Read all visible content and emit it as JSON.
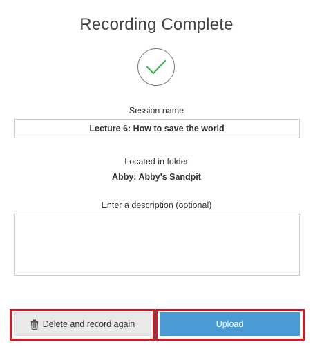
{
  "dialog": {
    "title": "Recording Complete",
    "status_icon": "checkmark-circle-icon",
    "accent_color": "#3cb550"
  },
  "session": {
    "label": "Session name",
    "value": "Lecture 6: How to save the world"
  },
  "folder": {
    "label": "Located in folder",
    "value": "Abby: Abby's Sandpit"
  },
  "description": {
    "label": "Enter a description (optional)",
    "value": "",
    "placeholder": ""
  },
  "actions": {
    "delete_label": "Delete and record again",
    "delete_icon": "trash-icon",
    "upload_label": "Upload",
    "upload_color": "#4a9bd4",
    "highlight_color": "#e0141e"
  }
}
